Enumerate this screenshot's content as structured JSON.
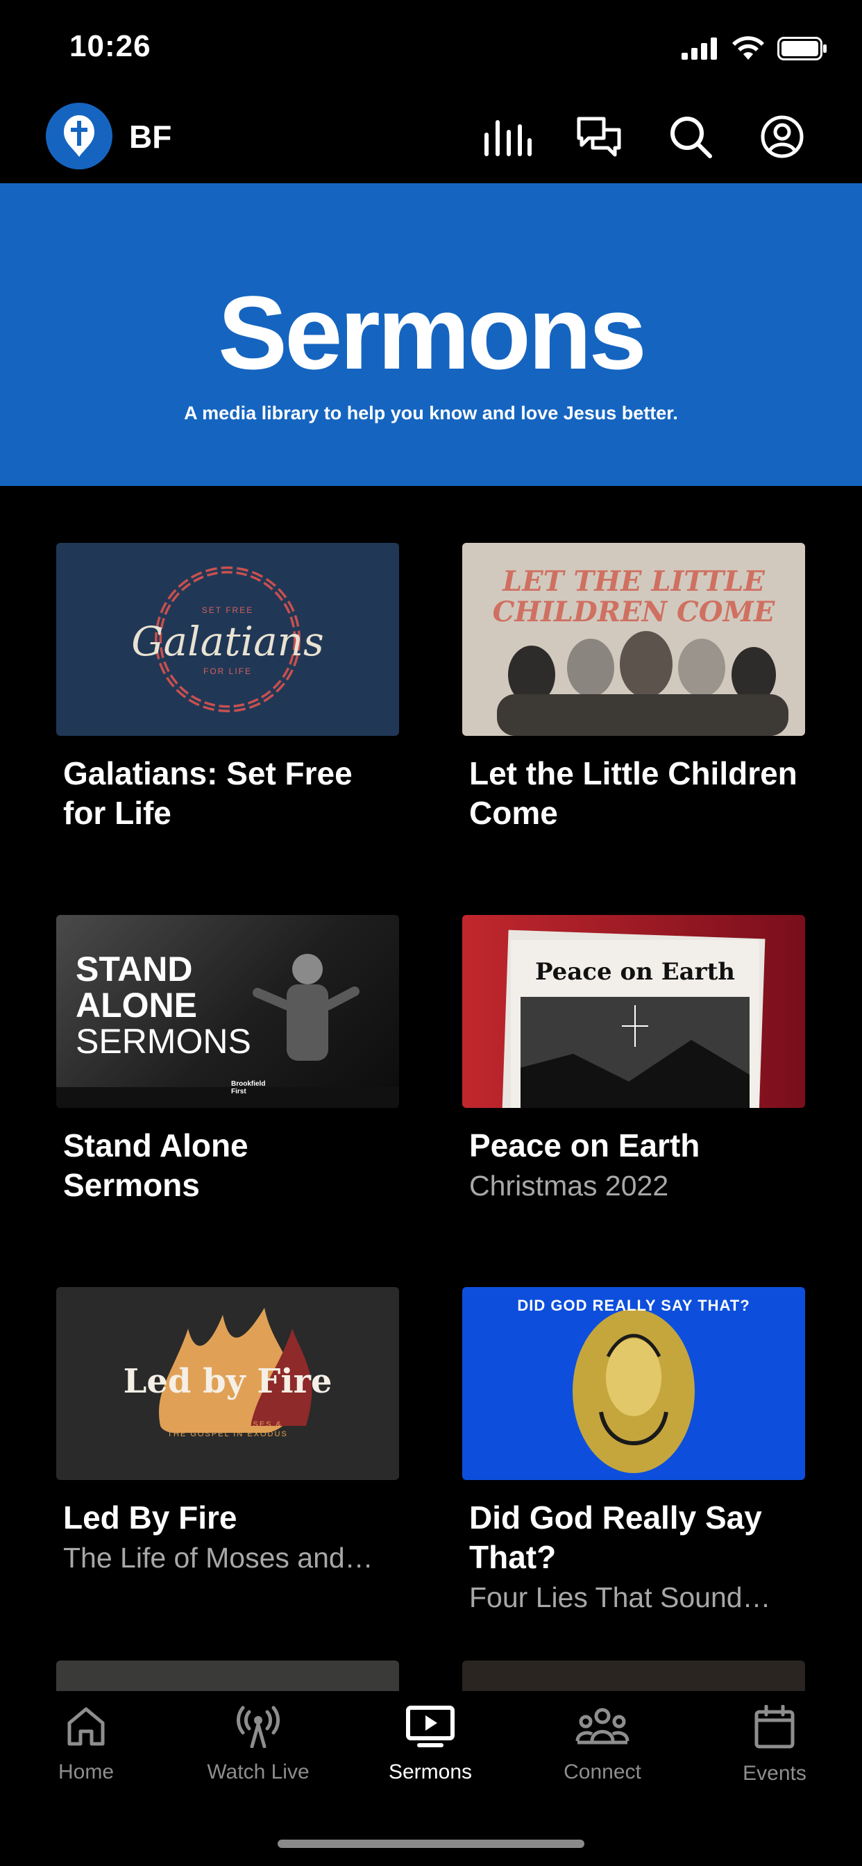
{
  "status_bar": {
    "time": "10:26"
  },
  "header": {
    "brand": "BF"
  },
  "hero": {
    "title": "Sermons",
    "subtitle": "A media library to help you know and love Jesus better."
  },
  "thumbnails": {
    "galatians": {
      "top": "SET FREE",
      "script": "Galatians",
      "bottom": "FOR LIFE"
    },
    "little_children": {
      "line1": "LET THE LITTLE",
      "line2": "CHILDREN COME"
    },
    "stand_alone": {
      "line1": "STAND",
      "line2": "ALONE",
      "line3": "SERMONS",
      "badge": "Brookfield First"
    },
    "peace": {
      "masthead": "Peace on Earth"
    },
    "fire": {
      "title": "Led by Fire",
      "sub1": "THE LIFE OF MOSES &",
      "sub2": "THE GOSPEL IN EXODUS"
    },
    "did_god": {
      "arc": "DID GOD REALLY SAY THAT?"
    }
  },
  "series": [
    {
      "title": "Galatians: Set Free for Life",
      "subtitle": ""
    },
    {
      "title": "Let the Little Children Come",
      "subtitle": ""
    },
    {
      "title": "Stand Alone Sermons",
      "subtitle": ""
    },
    {
      "title": "Peace on Earth",
      "subtitle": "Christmas 2022"
    },
    {
      "title": "Led By Fire",
      "subtitle": "The Life of Moses and…"
    },
    {
      "title": "Did God Really Say That?",
      "subtitle": "Four Lies That Sound…"
    }
  ],
  "tabs": [
    {
      "label": "Home",
      "icon": "home-icon"
    },
    {
      "label": "Watch Live",
      "icon": "broadcast-icon"
    },
    {
      "label": "Sermons",
      "icon": "play-screen-icon",
      "active": true
    },
    {
      "label": "Connect",
      "icon": "people-icon"
    },
    {
      "label": "Events",
      "icon": "calendar-icon"
    }
  ],
  "colors": {
    "brand_blue": "#1565c0",
    "background": "#000000",
    "subtitle_gray": "#a8a8a8"
  }
}
